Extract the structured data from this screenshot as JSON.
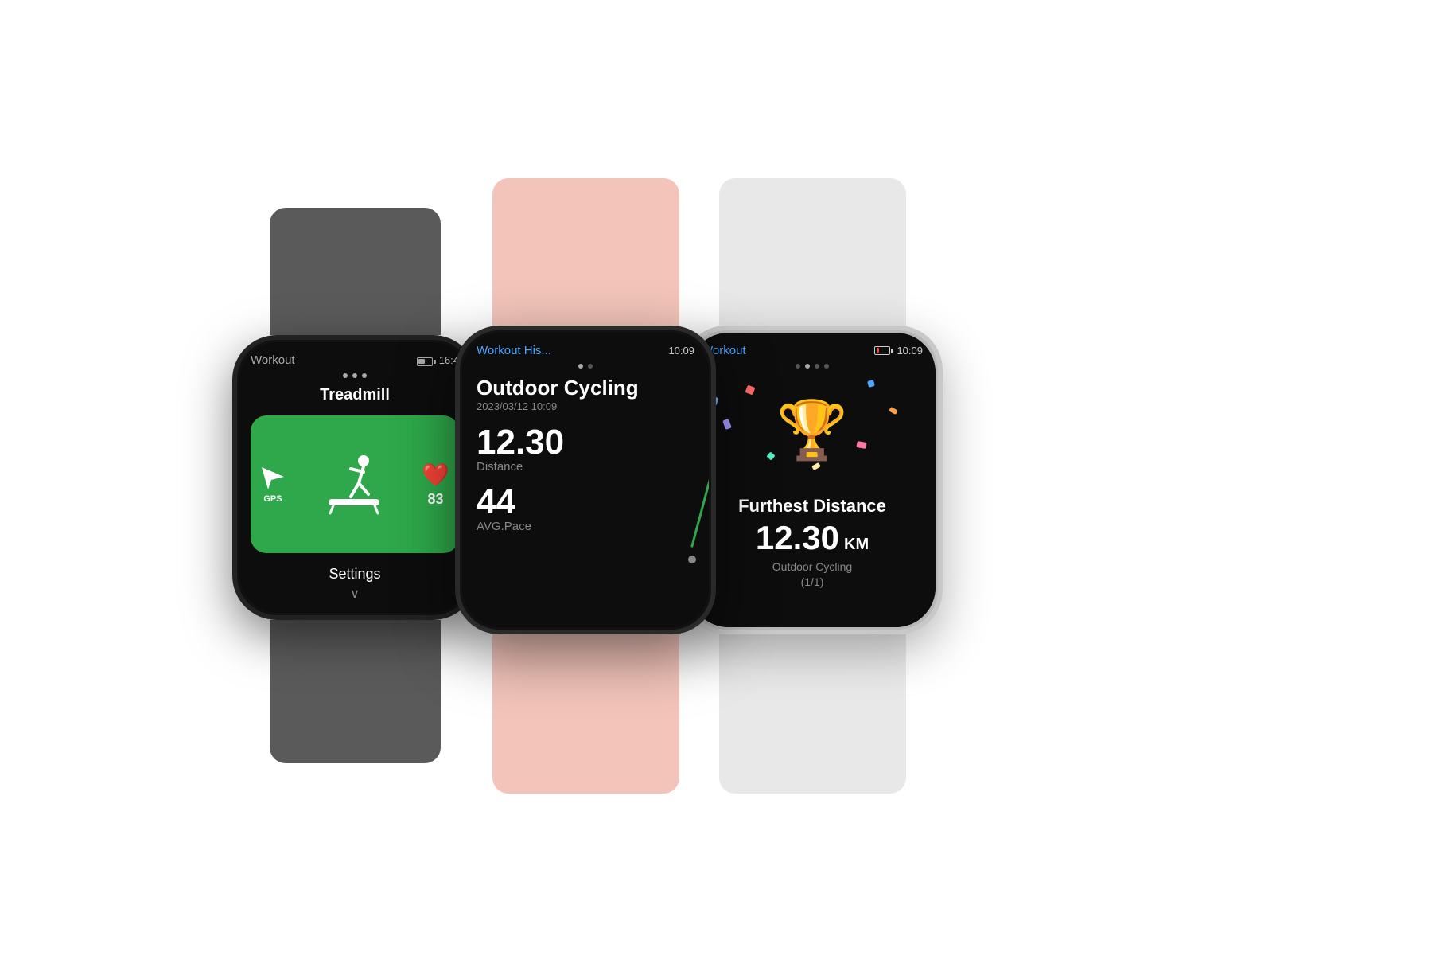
{
  "watches": {
    "left": {
      "band_color": "#5a5a5a",
      "title": "Workout",
      "time": "16:4",
      "dots": [
        true,
        true,
        true
      ],
      "active_dot": 1,
      "workout_type": "Treadmill",
      "gps_label": "GPS",
      "heart_rate": "83",
      "settings_label": "Settings",
      "chevron": "∨"
    },
    "middle": {
      "band_color": "#f2c4ba",
      "title": "Workout His...",
      "time": "10:09",
      "dots": [
        true,
        true
      ],
      "active_dot": 0,
      "activity": "Outdoor Cycling",
      "date": "2023/03/12 10:09",
      "distance_value": "12.30",
      "distance_label": "Distance",
      "pace_value": "44",
      "pace_label": "AVG.Pace"
    },
    "right": {
      "band_color": "#e8e8e8",
      "title": "Workout",
      "time": "10:09",
      "dots": [
        true,
        true,
        true,
        true
      ],
      "active_dot": 1,
      "achievement_label": "Furthest Distance",
      "achievement_value": "12.30",
      "achievement_unit": "KM",
      "achievement_sub": "Outdoor Cycling\n(1/1)"
    }
  }
}
